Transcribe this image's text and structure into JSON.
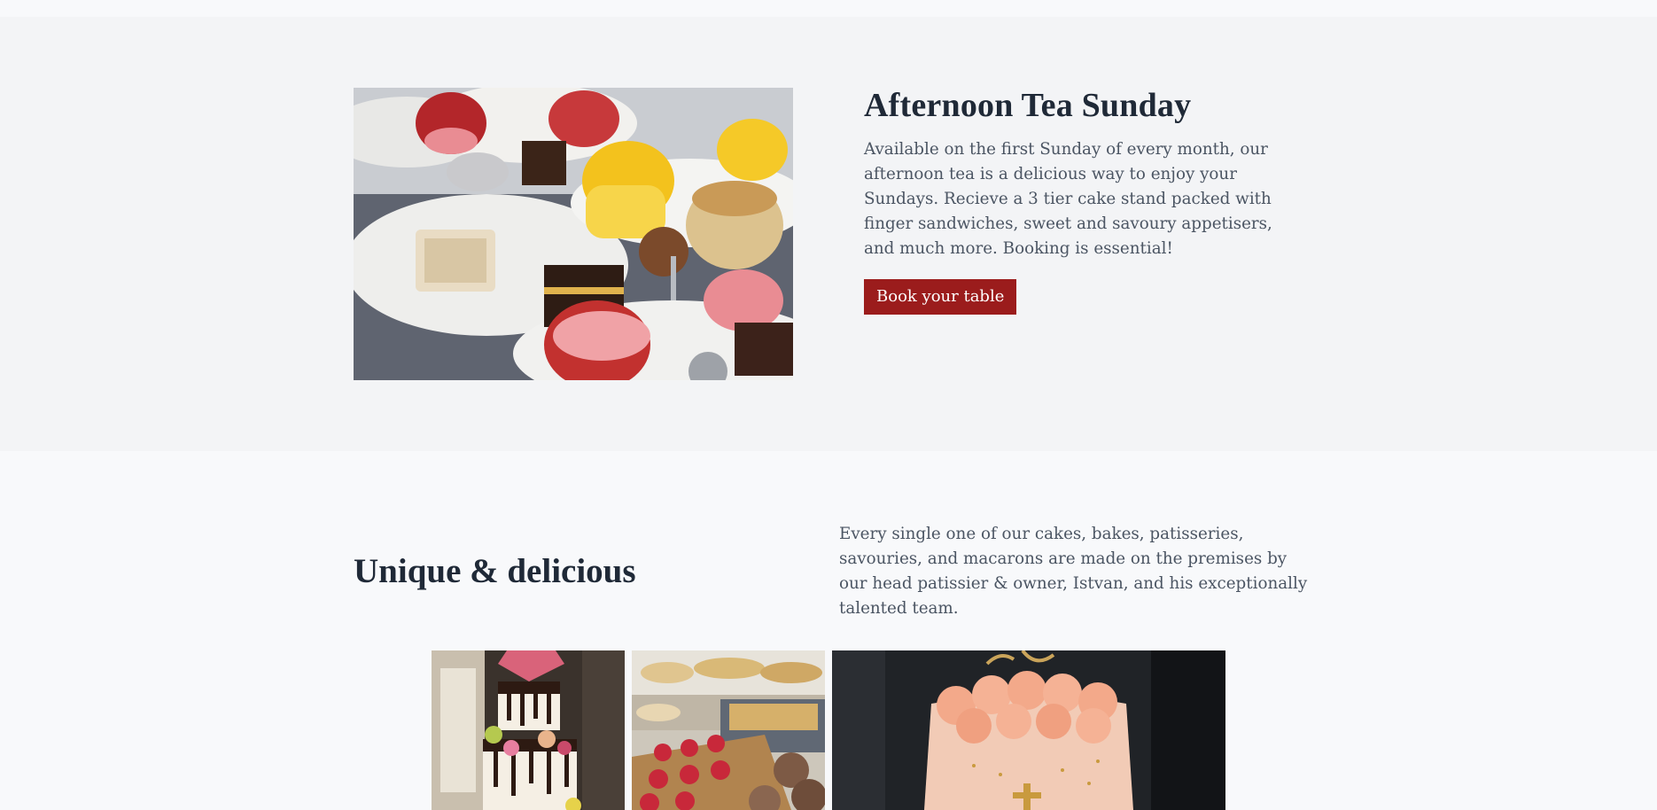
{
  "afternoon_tea": {
    "title": "Afternoon Tea Sunday",
    "description": "Available on the first Sunday of every month, our afternoon tea is a delicious way to enjoy your Sundays. Recieve a 3 tier cake stand packed with finger sandwiches, sweet and savoury appetisers, and much more. Booking is essential!",
    "button_label": "Book your table",
    "image_label": "afternoon-tea-stand-photo"
  },
  "unique": {
    "title": "Unique & delicious",
    "description": "Every single one of our cakes, bakes, patisseries, savouries, and macarons are made on the premises by our head patissier & owner, Istvan, and his exceptionally talented team."
  },
  "gallery": [
    {
      "name": "wedding-cake-photo"
    },
    {
      "name": "pastry-display-photo"
    },
    {
      "name": "peach-celebration-cake-photo"
    }
  ],
  "colors": {
    "accent": "#9b1c1c",
    "section_bg": "#f3f4f6",
    "page_bg": "#f8f9fb",
    "heading": "#1f2937",
    "body_text": "#4b5563"
  }
}
